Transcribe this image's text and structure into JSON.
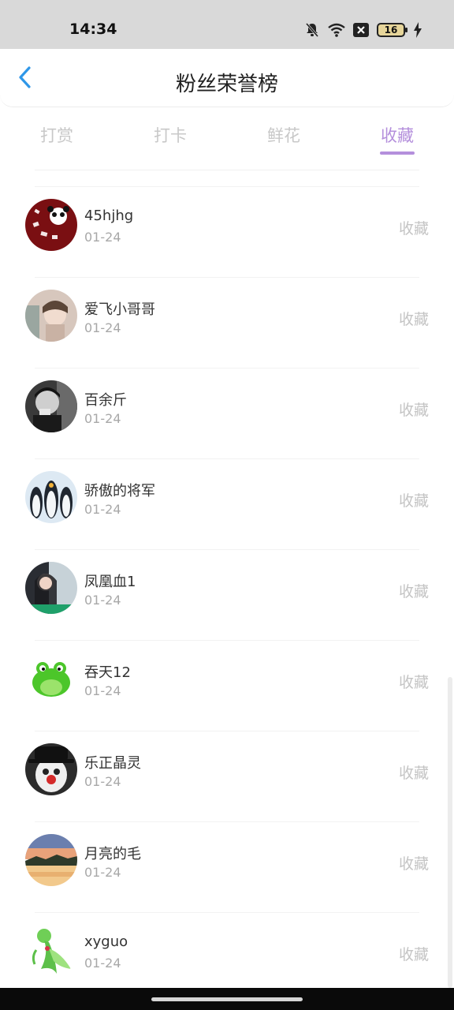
{
  "status_bar": {
    "time": "14:34",
    "battery": "16",
    "icons": [
      "bell-off-icon",
      "wifi-icon",
      "x-box-icon",
      "battery-icon",
      "charging-bolt-icon"
    ]
  },
  "header": {
    "title": "粉丝荣誉榜",
    "back_icon": "chevron-left-icon",
    "accent_color": "#2f97e8"
  },
  "tabs": [
    {
      "label": "打赏",
      "active": false
    },
    {
      "label": "打卡",
      "active": false
    },
    {
      "label": "鲜花",
      "active": false
    },
    {
      "label": "收藏",
      "active": true
    }
  ],
  "active_color": "#b48fdc",
  "fans": [
    {
      "name": "45hjhg",
      "date": "01-24",
      "action": "收藏"
    },
    {
      "name": "爱飞小哥哥",
      "date": "01-24",
      "action": "收藏"
    },
    {
      "name": "百余斤",
      "date": "01-24",
      "action": "收藏"
    },
    {
      "name": "骄傲的将军",
      "date": "01-24",
      "action": "收藏"
    },
    {
      "name": "凤凰血1",
      "date": "01-24",
      "action": "收藏"
    },
    {
      "name": "吞天12",
      "date": "01-24",
      "action": "收藏"
    },
    {
      "name": "乐正晶灵",
      "date": "01-24",
      "action": "收藏"
    },
    {
      "name": "月亮的毛",
      "date": "01-24",
      "action": "收藏"
    },
    {
      "name": "xyguo",
      "date": "01-24",
      "action": "收藏"
    }
  ]
}
